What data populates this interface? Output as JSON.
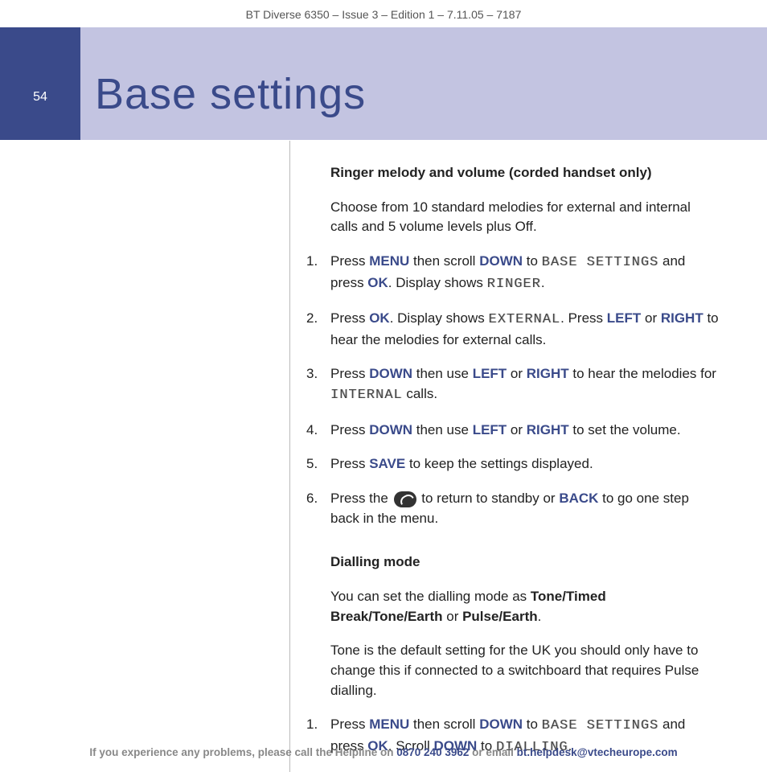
{
  "header": "BT Diverse 6350 – Issue 3 – Edition 1 – 7.11.05 – 7187",
  "pageNumber": "54",
  "title": "Base settings",
  "section1": {
    "heading": "Ringer melody and volume (corded handset only)",
    "intro": "Choose from 10 standard melodies for external and internal calls and 5 volume levels plus Off.",
    "steps": [
      {
        "n": "1.",
        "pre": "Press ",
        "k1": "MENU",
        "mid1": " then scroll ",
        "k2": "DOWN",
        "mid2": " to ",
        "lcd1": "BASE SETTINGS",
        "mid3": " and press ",
        "k3": "OK",
        "mid4": ". Display shows ",
        "lcd2": "RINGER",
        "post": "."
      },
      {
        "n": "2.",
        "pre": "Press ",
        "k1": "OK",
        "mid1": ". Display shows ",
        "lcd1": "EXTERNAL",
        "mid2": ". Press ",
        "k2": "LEFT",
        "mid3": " or ",
        "k3": "RIGHT",
        "post": " to hear the melodies for external calls."
      },
      {
        "n": "3.",
        "pre": "Press ",
        "k1": "DOWN",
        "mid1": " then use ",
        "k2": "LEFT",
        "mid2": " or ",
        "k3": "RIGHT",
        "mid3": " to hear the melodies for ",
        "lcd1": "INTERNAL",
        "post": " calls."
      },
      {
        "n": "4.",
        "pre": "Press ",
        "k1": "DOWN",
        "mid1": " then use ",
        "k2": "LEFT",
        "mid2": " or ",
        "k3": "RIGHT",
        "post": " to set the volume."
      },
      {
        "n": "5.",
        "pre": "Press ",
        "k1": "SAVE",
        "post": " to keep the settings displayed."
      },
      {
        "n": "6.",
        "pre": "Press the ",
        "icon": true,
        "mid1": " to return to standby or ",
        "k1": "BACK",
        "post": " to go one step back in the menu."
      }
    ]
  },
  "section2": {
    "heading": "Dialling mode",
    "intro1a": "You can set the dialling mode as ",
    "intro1b": "Tone/Timed Break/Tone/Earth",
    "intro1c": " or ",
    "intro1d": "Pulse/Earth",
    "intro1e": ".",
    "intro2": "Tone is the default setting for the UK you should only have to change this if connected to a switchboard that requires Pulse dialling.",
    "steps": [
      {
        "n": "1.",
        "pre": "Press ",
        "k1": "MENU",
        "mid1": " then scroll ",
        "k2": "DOWN",
        "mid2": " to ",
        "lcd1": "BASE SETTINGS",
        "mid3": " and press ",
        "k3": "OK",
        "mid4": ". Scroll ",
        "k4": "DOWN",
        "mid5": " to ",
        "lcd2": "DIALLING",
        "post": "."
      }
    ]
  },
  "footer": {
    "t1": "If you experience any problems, please call the Helpline on ",
    "phone": "0870 240 3962",
    "t2": " or email ",
    "email": "bt.helpdesk@vtecheurope.com"
  }
}
